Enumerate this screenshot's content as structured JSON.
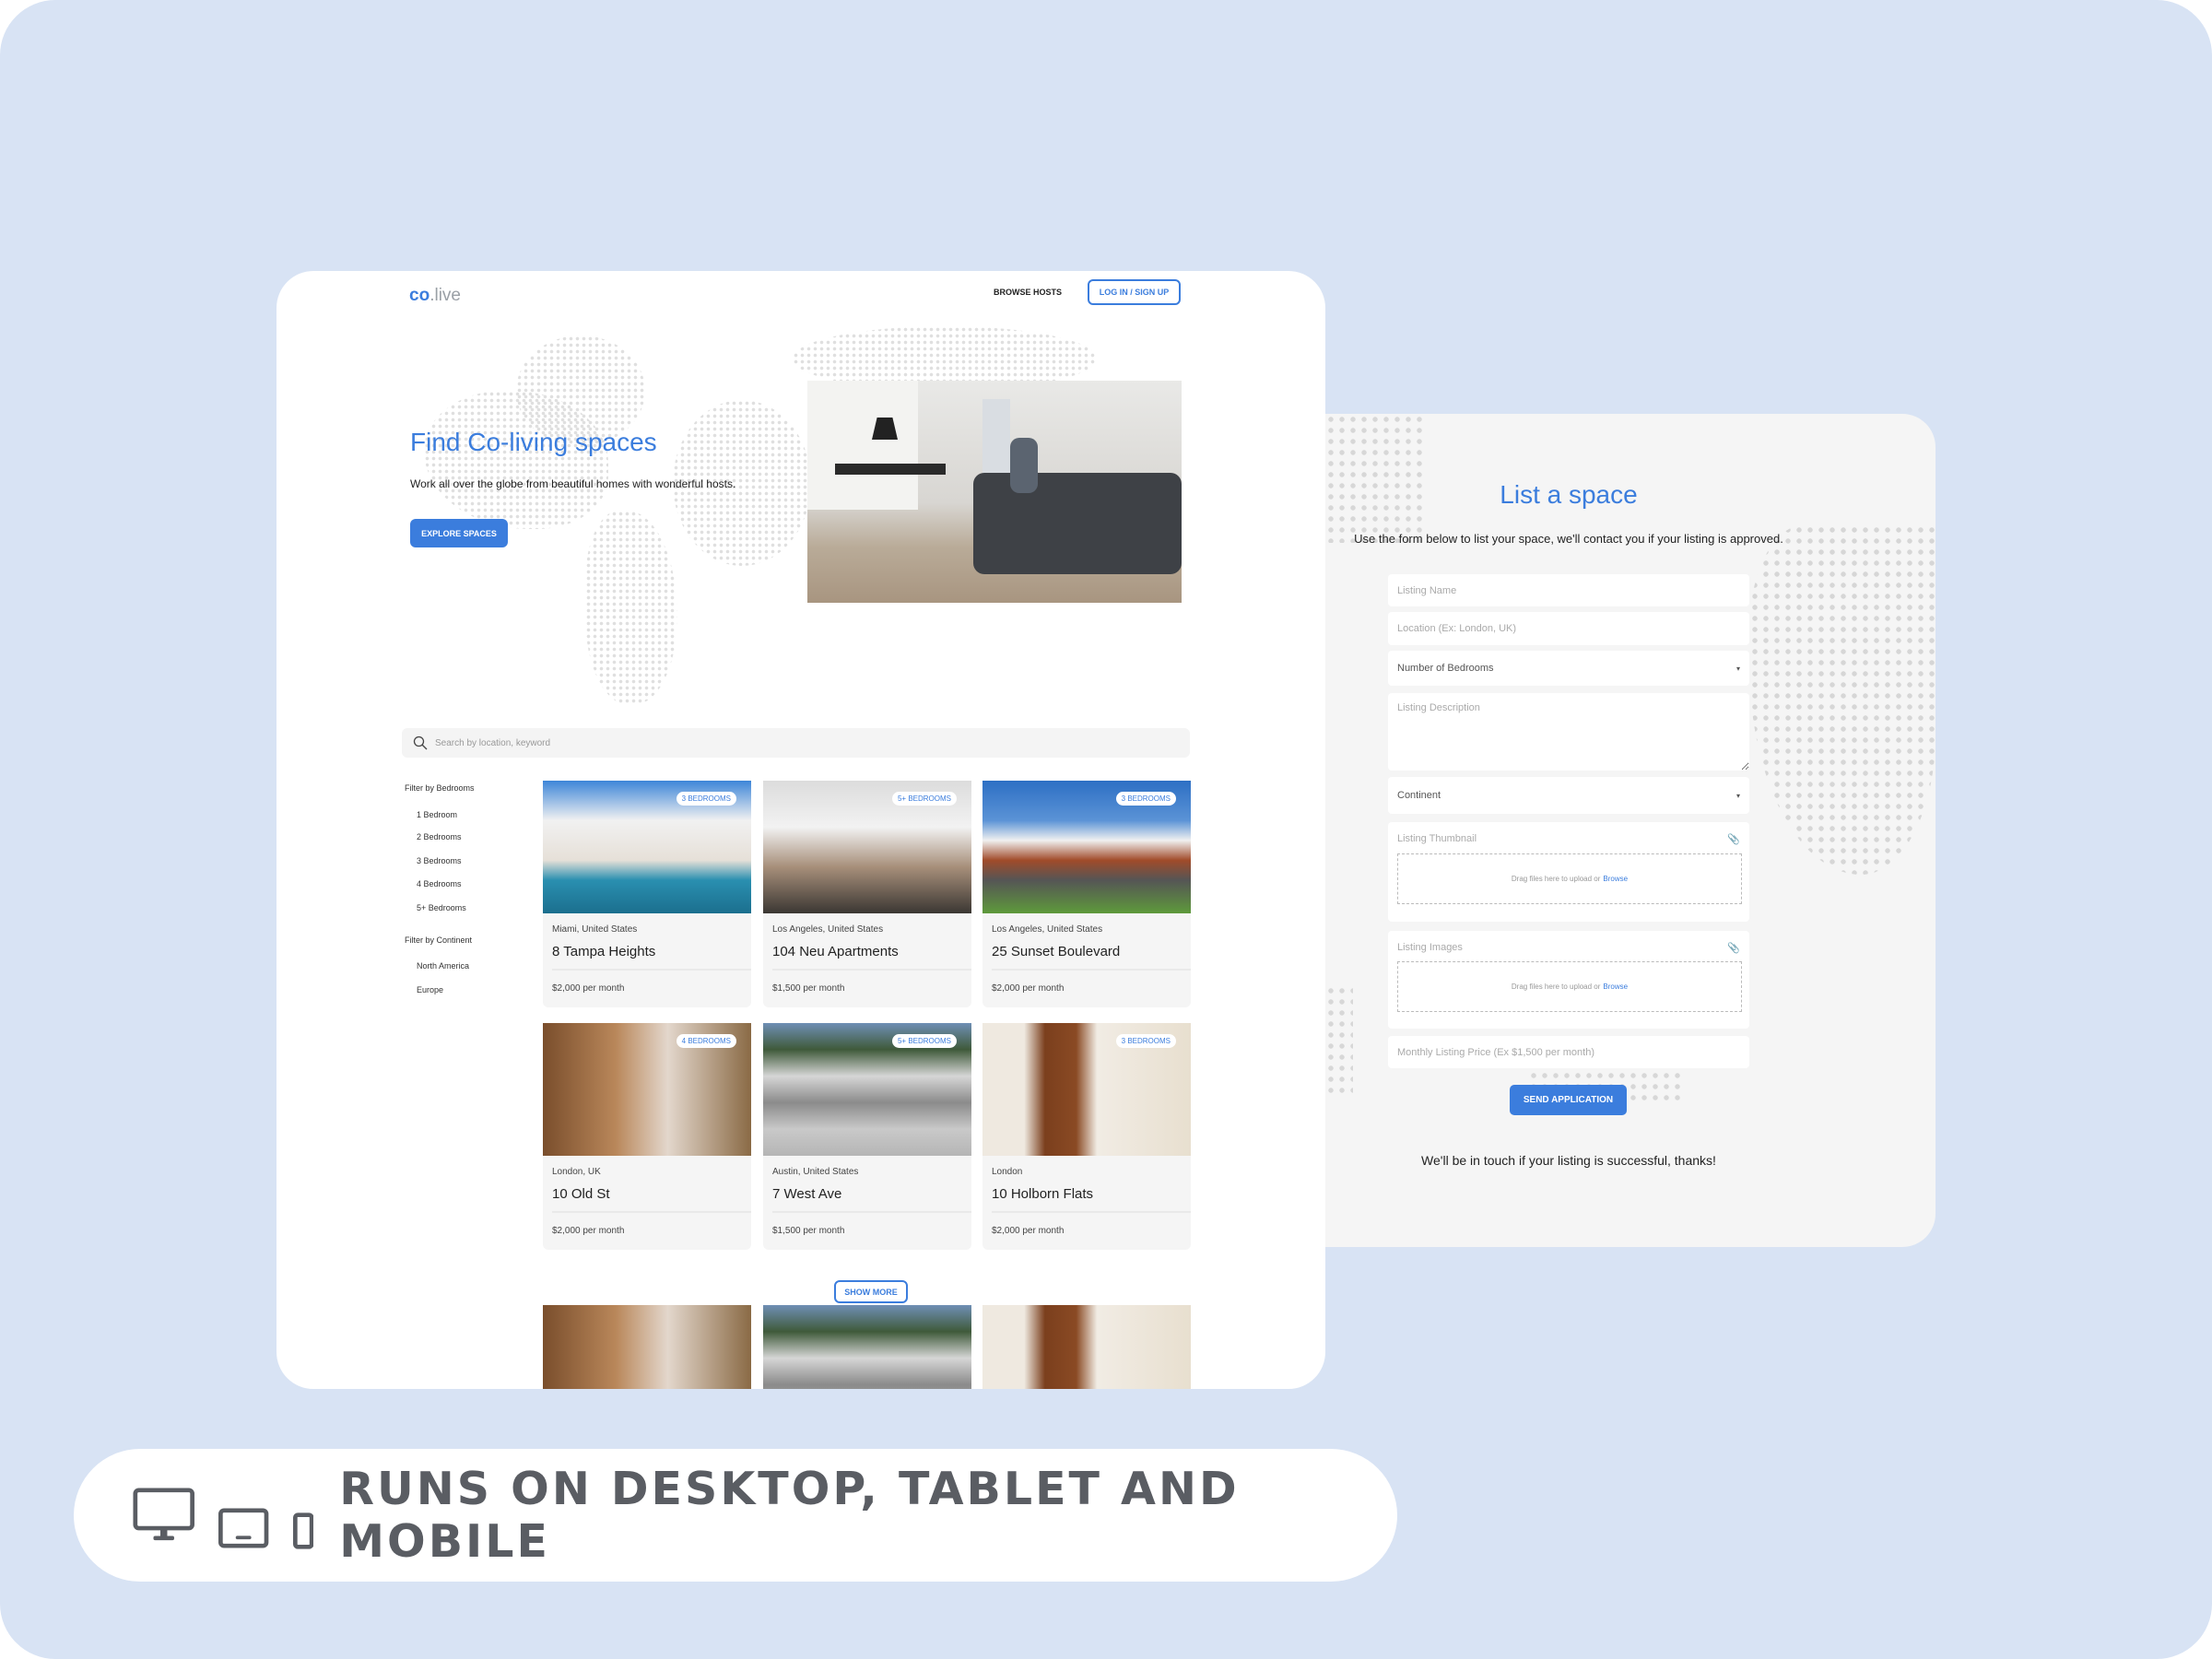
{
  "colors": {
    "accent": "#3b7ddd",
    "background": "#d8e3f4",
    "text_dark": "#222222",
    "banner_text": "#5a5d63"
  },
  "site": {
    "logo_main": "co",
    "logo_suffix": ".live",
    "nav": {
      "browse_hosts": "BROWSE HOSTS",
      "login": "LOG IN / SIGN UP"
    },
    "hero": {
      "title": "Find Co-living spaces",
      "subtitle": "Work all over the globe from beautiful homes with wonderful hosts.",
      "button": "EXPLORE SPACES"
    },
    "search": {
      "placeholder": "Search by location, keyword",
      "icon": "search-icon"
    },
    "filters": {
      "bedrooms_label": "Filter by Bedrooms",
      "bedrooms": [
        "1 Bedroom",
        "2 Bedrooms",
        "3 Bedrooms",
        "4 Bedrooms",
        "5+ Bedrooms"
      ],
      "continent_label": "Filter by Continent",
      "continents": [
        "North America",
        "Europe"
      ]
    },
    "listings": [
      {
        "badge": "3 BEDROOMS",
        "location": "Miami, United States",
        "title": "8 Tampa Heights",
        "price": "$2,000 per month"
      },
      {
        "badge": "5+ BEDROOMS",
        "location": "Los Angeles, United States",
        "title": "104 Neu Apartments",
        "price": "$1,500 per month"
      },
      {
        "badge": "3 BEDROOMS",
        "location": "Los Angeles, United States",
        "title": "25 Sunset Boulevard",
        "price": "$2,000 per month"
      },
      {
        "badge": "4 BEDROOMS",
        "location": "London, UK",
        "title": "10 Old St",
        "price": "$2,000 per month"
      },
      {
        "badge": "5+ BEDROOMS",
        "location": "Austin, United States",
        "title": "7 West Ave",
        "price": "$1,500 per month"
      },
      {
        "badge": "3 BEDROOMS",
        "location": "London",
        "title": "10 Holborn Flats",
        "price": "$2,000 per month"
      }
    ],
    "show_more": "SHOW MORE"
  },
  "form": {
    "title": "List a space",
    "description": "Use the form below to list your space, we'll contact you if your listing is approved.",
    "listing_name": "Listing Name",
    "location": "Location (Ex: London, UK)",
    "bedrooms": "Number of Bedrooms",
    "listing_description": "Listing Description",
    "continent": "Continent",
    "thumbnail": "Listing Thumbnail",
    "images": "Listing Images",
    "drop_text": "Drag files here to upload or",
    "browse": "Browse",
    "price": "Monthly Listing Price (Ex $1,500 per month)",
    "submit": "SEND APPLICATION",
    "thanks": "We'll be in touch if your listing is successful, thanks!"
  },
  "banner": {
    "text": "RUNS ON DESKTOP, TABLET AND MOBILE",
    "icons": [
      "desktop-icon",
      "tablet-icon",
      "mobile-icon"
    ]
  }
}
